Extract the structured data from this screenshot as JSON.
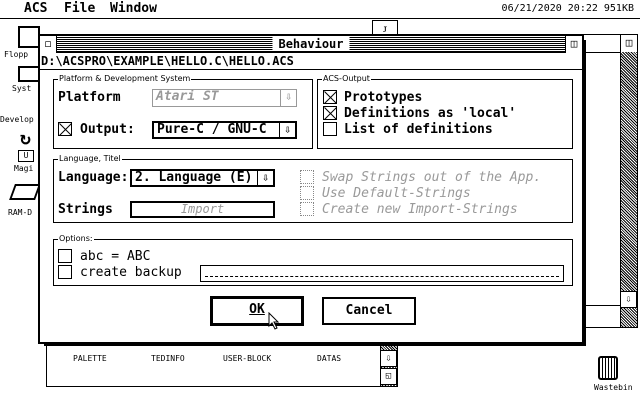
{
  "menubar": {
    "items": [
      "ACS",
      "File",
      "Window"
    ],
    "status": "06/21/2020 20:22 951KB"
  },
  "desktop": {
    "icons": {
      "floppy": "Flopp",
      "system": "Syst",
      "develop": "Develop",
      "magic": "Magi",
      "ramdisk": "RAM-D",
      "trash": "Wastebin"
    },
    "bg_window_labels": [
      "PALETTE",
      "TEDINFO",
      "USER-BLOCK",
      "DATAS"
    ]
  },
  "dialog": {
    "title": "Behaviour",
    "path": "D:\\ACSPRO\\EXAMPLE\\HELLO.C\\HELLO.ACS",
    "platform_group": {
      "title": "Platform & Development System",
      "platform_label": "Platform",
      "platform_value": "Atari ST",
      "output_label": "Output:",
      "output_checked": true,
      "output_value": "Pure-C / GNU-C"
    },
    "acs_output": {
      "title": "ACS-Output",
      "items": [
        {
          "label": "Prototypes",
          "checked": true
        },
        {
          "label": "Definitions as 'local'",
          "checked": true
        },
        {
          "label": "List of definitions",
          "checked": false
        }
      ]
    },
    "language_group": {
      "title": "Language, Titel",
      "language_label": "Language:",
      "language_value": "2. Language (E)",
      "strings_label": "Strings",
      "import_label": "Import",
      "options": [
        "Swap Strings out of the App.",
        "Use Default-Strings",
        "Create new Import-Strings"
      ]
    },
    "options_group": {
      "title": "Options:",
      "abc_label": "abc = ABC",
      "backup_label": "create backup",
      "backup_value": ""
    },
    "buttons": {
      "ok": "OK",
      "cancel": "Cancel"
    }
  }
}
